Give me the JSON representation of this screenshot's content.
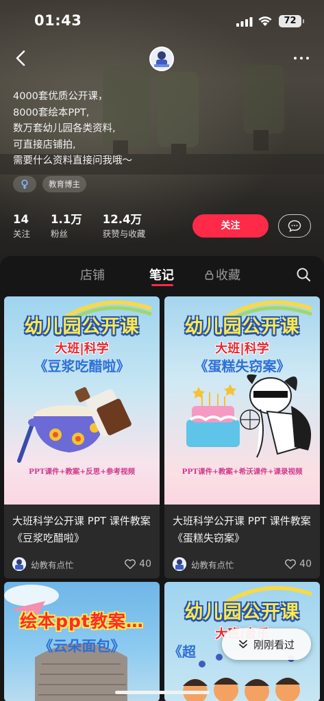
{
  "status_bar": {
    "time": "01:43",
    "battery": "72"
  },
  "profile": {
    "bio_lines": [
      "4000套优质公开课，",
      "8000套绘本PPT,",
      "数万套幼儿园各类资料,",
      "可直接店铺拍,",
      "需要什么资料直接问我哦～"
    ],
    "tags": {
      "gender_icon": "female-symbol-icon",
      "category": "教育博主"
    },
    "stats": [
      {
        "value": "14",
        "label": "关注"
      },
      {
        "value": "1.1万",
        "label": "粉丝"
      },
      {
        "value": "12.4万",
        "label": "获赞与收藏"
      }
    ],
    "follow_label": "关注"
  },
  "tabs": {
    "shop": "店铺",
    "notes": "笔记",
    "favorites": "收藏",
    "active": "notes"
  },
  "notes": [
    {
      "cover_title": "幼儿园公开课",
      "cover_subtitle": "大班|科学",
      "cover_book": "《豆浆吃醋啦》",
      "cover_footer": "PPT课件+教案+反思+参考视频",
      "title": "大班科学公开课 PPT 课件教案《豆浆吃醋啦》",
      "author": "幼教有点忙",
      "likes": "40"
    },
    {
      "cover_title": "幼儿园公开课",
      "cover_subtitle": "大班|科学",
      "cover_book": "《蛋糕失窃案》",
      "cover_footer": "PPT课件+教案+希沃课件+课录视频",
      "title": "大班科学公开课 PPT 课件教案《蛋糕失窃案》",
      "author": "幼教有点忙",
      "likes": "40"
    },
    {
      "cover_title": "绘本ppt教案…",
      "cover_book": "《云朵面包》"
    },
    {
      "cover_title": "幼儿园公开课",
      "cover_subtitle": "大班|音乐",
      "cover_book": "《超"
    }
  ],
  "recent_pill": {
    "label": "刚刚看过"
  },
  "colors": {
    "accent": "#ff2a48",
    "background": "#161616",
    "card": "#2a2a2a"
  }
}
